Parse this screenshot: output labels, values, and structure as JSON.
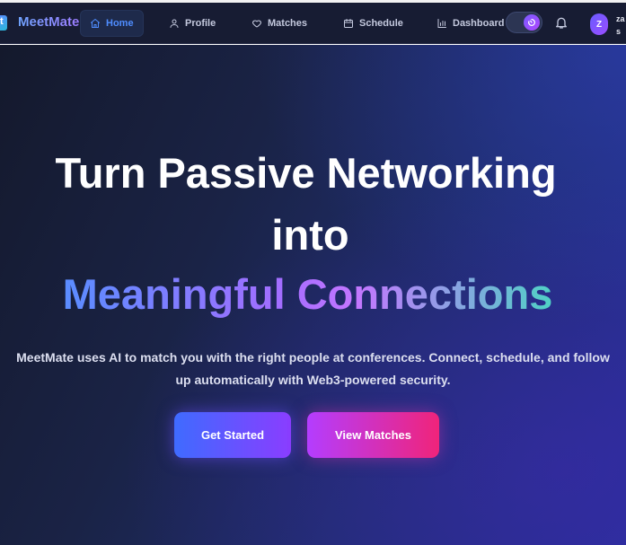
{
  "brand": {
    "name": "MeetMate",
    "icon": "app-logo-icon",
    "icon_glyph": "t"
  },
  "nav": {
    "items": [
      {
        "label": "Home",
        "icon": "home-icon",
        "active": true
      },
      {
        "label": "Profile",
        "icon": "user-icon",
        "active": false
      },
      {
        "label": "Matches",
        "icon": "heart-icon",
        "active": false
      },
      {
        "label": "Schedule",
        "icon": "calendar-icon",
        "active": false
      },
      {
        "label": "Dashboard",
        "icon": "bar-chart-icon",
        "active": false
      }
    ],
    "theme_toggle_icon": "theme-toggle-icon",
    "notifications_icon": "bell-icon",
    "avatar_initial": "Z",
    "user_name_line1": "za",
    "user_name_line2": "s"
  },
  "hero": {
    "headline_line1": "Turn Passive Networking",
    "headline_line2": "into",
    "headline_line3": "Meaningful Connections",
    "subtitle_line1": "MeetMate uses AI to match you with the right people at conferences. Connect, schedule, and follow",
    "subtitle_line2": "up automatically with Web3-powered security.",
    "primary_button": "Get Started",
    "secondary_button": "View Matches"
  },
  "colors": {
    "nav_background": "#171c33",
    "accent_blue": "#4f8dff",
    "accent_purple": "#8a3dff",
    "accent_pink": "#f0247a",
    "accent_teal": "#4fd1c5"
  }
}
